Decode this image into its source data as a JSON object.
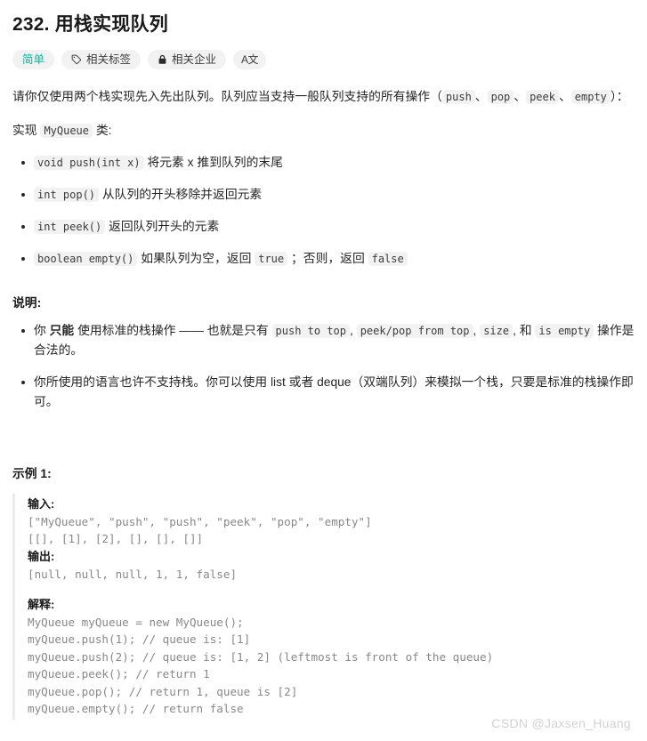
{
  "problem": {
    "title": "232. 用栈实现队列",
    "badges": [
      {
        "label": "简单",
        "icon": "none",
        "type": "difficulty"
      },
      {
        "label": "相关标签",
        "icon": "tag-icon",
        "type": "normal"
      },
      {
        "label": "相关企业",
        "icon": "lock-icon",
        "type": "normal"
      },
      {
        "label": "A文",
        "icon": "translate-icon",
        "type": "icon-only"
      }
    ],
    "intro": {
      "prefix": "请你仅使用两个栈实现先入先出队列。队列应当支持一般队列支持的所有操作（",
      "codes": [
        "push",
        "pop",
        "peek",
        "empty"
      ],
      "separator": "、",
      "suffix": "）：",
      "line2_prefix": "实现 ",
      "line2_code": "MyQueue",
      "line2_suffix": " 类:"
    },
    "methods": [
      {
        "code": "void push(int x)",
        "text": "将元素 x 推到队列的末尾"
      },
      {
        "code": "int pop()",
        "text": "从队列的开头移除并返回元素"
      },
      {
        "code": "int peek()",
        "text": "返回队列开头的元素"
      },
      {
        "code": "boolean empty()",
        "text_a": "如果队列为空，返回 ",
        "code_true": "true",
        "text_b": " ；否则，返回 ",
        "code_false": "false"
      }
    ],
    "notes_title": "说明:",
    "notes": [
      {
        "a": "你 ",
        "strong": "只能",
        "b": " 使用标准的栈操作 —— 也就是只有 ",
        "c1": "push to top",
        "d": ", ",
        "c2": "peek/pop from top",
        "e": ", ",
        "c3": "size",
        "f": ", 和 ",
        "c4": "is empty",
        "g": " 操作是合法的。"
      },
      {
        "text": "你所使用的语言也许不支持栈。你可以使用 list 或者 deque（双端队列）来模拟一个栈，只要是标准的栈操作即可。"
      }
    ],
    "example_title": "示例 1:",
    "example": {
      "input_label": "输入:",
      "input_lines": [
        "[\"MyQueue\", \"push\", \"push\", \"peek\", \"pop\", \"empty\"]",
        "[[], [1], [2], [], [], []]"
      ],
      "output_label": "输出:",
      "output_lines": [
        "[null, null, null, 1, 1, false]"
      ],
      "explain_label": "解释:",
      "explain_lines": [
        "MyQueue myQueue = new MyQueue();",
        "myQueue.push(1); // queue is: [1]",
        "myQueue.push(2); // queue is: [1, 2] (leftmost is front of the queue)",
        "myQueue.peek(); // return 1",
        "myQueue.pop(); // return 1, queue is [2]",
        "myQueue.empty(); // return false"
      ]
    }
  },
  "watermark": "CSDN @Jaxsen_Huang",
  "colors": {
    "difficulty_easy": "#00b8a3",
    "inline_code_bg": "#f2f2f2",
    "code_text": "#888888",
    "body_text": "#262626",
    "watermark": "#d2d2d2"
  }
}
